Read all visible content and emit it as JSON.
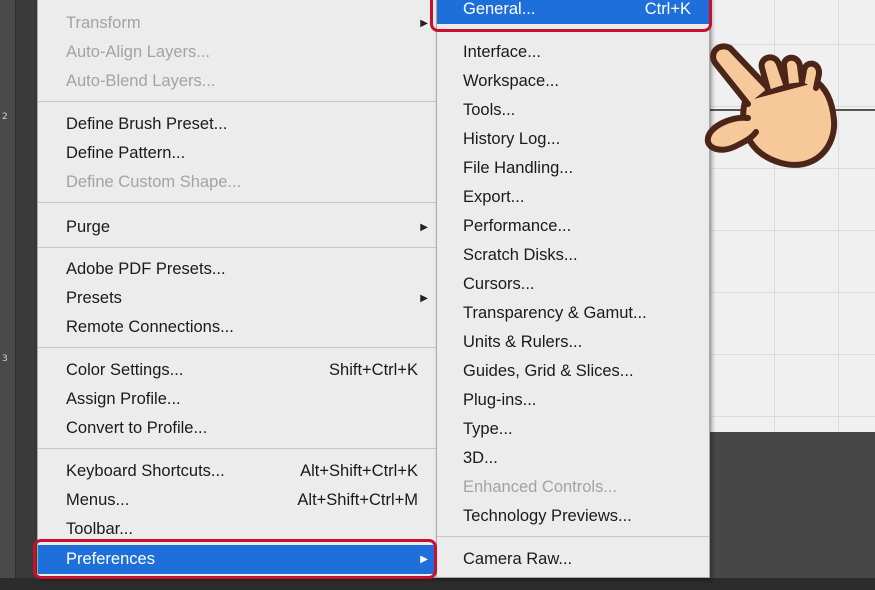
{
  "main_menu": {
    "items": [
      {
        "label": "Transform",
        "disabled": true,
        "submenu": true
      },
      {
        "label": "Auto-Align Layers...",
        "disabled": true
      },
      {
        "label": "Auto-Blend Layers...",
        "disabled": true
      },
      {
        "label": "Define Brush Preset..."
      },
      {
        "label": "Define Pattern..."
      },
      {
        "label": "Define Custom Shape...",
        "disabled": true
      },
      {
        "label": "Purge",
        "submenu": true
      },
      {
        "label": "Adobe PDF Presets..."
      },
      {
        "label": "Presets",
        "submenu": true
      },
      {
        "label": "Remote Connections..."
      },
      {
        "label": "Color Settings...",
        "shortcut": "Shift+Ctrl+K"
      },
      {
        "label": "Assign Profile..."
      },
      {
        "label": "Convert to Profile..."
      },
      {
        "label": "Keyboard Shortcuts...",
        "shortcut": "Alt+Shift+Ctrl+K"
      },
      {
        "label": "Menus...",
        "shortcut": "Alt+Shift+Ctrl+M"
      },
      {
        "label": "Toolbar..."
      },
      {
        "label": "Preferences",
        "submenu": true,
        "highlighted": true
      }
    ]
  },
  "preferences_submenu": {
    "items": [
      {
        "label": "General...",
        "shortcut": "Ctrl+K",
        "highlighted": true
      },
      {
        "label": "Interface..."
      },
      {
        "label": "Workspace..."
      },
      {
        "label": "Tools..."
      },
      {
        "label": "History Log..."
      },
      {
        "label": "File Handling..."
      },
      {
        "label": "Export..."
      },
      {
        "label": "Performance..."
      },
      {
        "label": "Scratch Disks..."
      },
      {
        "label": "Cursors..."
      },
      {
        "label": "Transparency & Gamut..."
      },
      {
        "label": "Units & Rulers..."
      },
      {
        "label": "Guides, Grid & Slices..."
      },
      {
        "label": "Plug-ins..."
      },
      {
        "label": "Type..."
      },
      {
        "label": "3D..."
      },
      {
        "label": "Enhanced Controls...",
        "disabled": true
      },
      {
        "label": "Technology Previews..."
      },
      {
        "label": "Camera Raw..."
      }
    ]
  },
  "ruler": {
    "tick_2": "2",
    "tick_3": "3"
  },
  "colors": {
    "highlight": "#1e6fd9",
    "callout_outline": "#c8102e",
    "menu_bg": "#ececec"
  },
  "icons": {
    "pointer": "pointing-hand-icon",
    "submenu": "triangle-right-icon"
  }
}
